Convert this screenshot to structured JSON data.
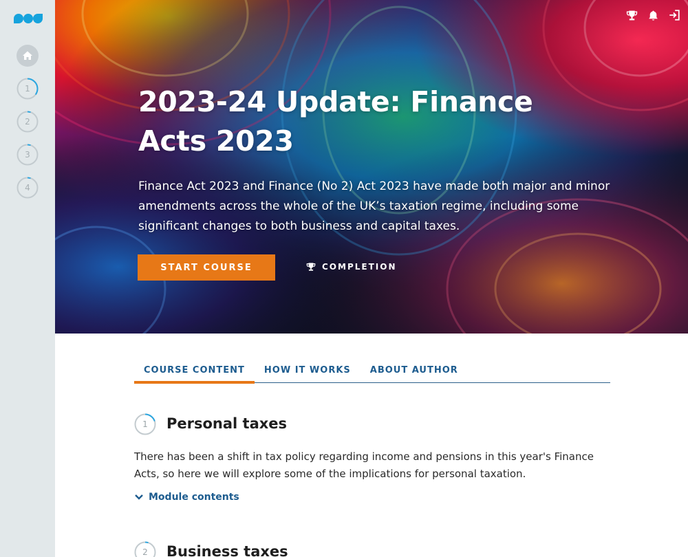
{
  "sidebar": {
    "logo": "edu-logo",
    "home_icon": "home-icon",
    "steps": [
      {
        "label": "1",
        "progress": 0.35
      },
      {
        "label": "2",
        "progress": 0.05
      },
      {
        "label": "3",
        "progress": 0.05
      },
      {
        "label": "4",
        "progress": 0.05
      }
    ]
  },
  "header": {
    "icons": [
      "trophy-icon",
      "bell-icon",
      "logout-icon"
    ]
  },
  "hero": {
    "title": "2023-24 Update: Finance Acts 2023",
    "description": "Finance Act 2023 and Finance (No 2) Act 2023 have made both major and minor amendments across the whole of the UK’s taxation regime, including some significant changes to both business and capital taxes.",
    "start_button": "START COURSE",
    "completion_button": "COMPLETION"
  },
  "tabs": [
    {
      "label": "COURSE CONTENT",
      "active": true
    },
    {
      "label": "HOW IT WORKS",
      "active": false
    },
    {
      "label": "ABOUT AUTHOR",
      "active": false
    }
  ],
  "modules": [
    {
      "number": "1",
      "progress": 0.2,
      "title": "Personal taxes",
      "description": "There has been a shift in tax policy regarding income and pensions in this year's Finance Acts, so here we will explore some of the implications for personal taxation.",
      "toggle_label": "Module contents"
    },
    {
      "number": "2",
      "progress": 0.05,
      "title": "Business taxes"
    }
  ],
  "colors": {
    "accent": "#e77817",
    "link": "#1d5c8f",
    "sidebar_bg": "#e2e8ea",
    "progress": "#2aa6e0"
  }
}
